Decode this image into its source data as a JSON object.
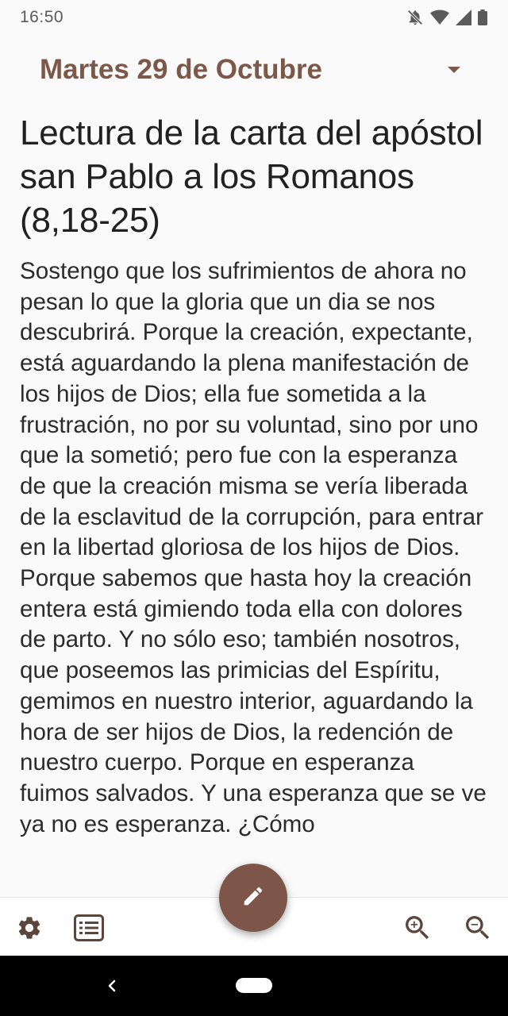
{
  "status_bar": {
    "time": "16:50",
    "icons": [
      "bell-off-icon",
      "wifi-icon",
      "signal-icon",
      "battery-icon"
    ]
  },
  "header": {
    "date": "Martes 29 de Octubre"
  },
  "reading": {
    "title": "Lectura de la carta del apóstol san Pablo a los Romanos (8,18-25)",
    "body": "Sostengo que los sufrimientos de ahora no pesan lo que la gloria que un dia se nos descubrirá. Porque la creación, expectante, está aguardando la plena manifestación de los hijos de Dios; ella fue sometida a la frustración, no por su voluntad, sino por uno que la sometió; pero fue con la esperanza de que la creación misma se vería liberada de la esclavitud de la corrupción, para entrar en la libertad gloriosa de los hijos de Dios. Porque sabemos que hasta hoy la creación entera está gimiendo toda ella con dolores de parto. Y no sólo eso; también nosotros, que poseemos las primicias del Espíritu, gemimos en nuestro interior, aguardando la hora de ser hijos de Dios, la redención de nuestro cuerpo. Porque en esperanza fuimos salvados. Y una esperanza que se ve ya no es esperanza. ¿Cómo"
  },
  "bottom_bar": {
    "icons": [
      "gear-icon",
      "list-icon",
      "pencil-icon",
      "zoom-in-icon",
      "zoom-out-icon"
    ]
  },
  "colors": {
    "accent": "#7b5848",
    "fab": "#7d5649",
    "icon": "#5b463c"
  }
}
